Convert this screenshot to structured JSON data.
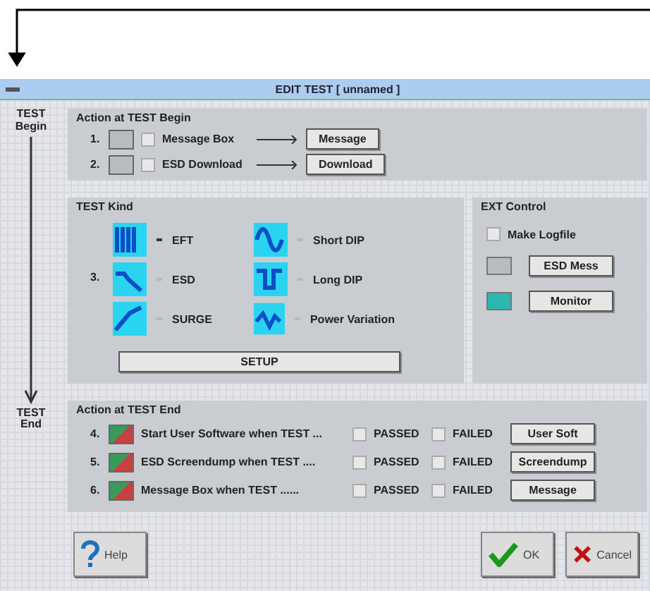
{
  "window": {
    "title": "EDIT TEST [ unnamed ]"
  },
  "timeline": {
    "start_label": "TEST Begin",
    "end_label": "TEST End"
  },
  "begin_actions": {
    "title": "Action at TEST Begin",
    "rows": [
      {
        "number": "1.",
        "label": "Message Box",
        "checked": false,
        "button": "Message"
      },
      {
        "number": "2.",
        "label": "ESD Download",
        "checked": false,
        "button": "Download"
      }
    ]
  },
  "test_kind": {
    "title": "TEST Kind",
    "number": "3.",
    "options": [
      {
        "label": "EFT",
        "selected": true,
        "kind": "burst"
      },
      {
        "label": "Short DIP",
        "selected": false,
        "kind": "sine"
      },
      {
        "label": "ESD",
        "selected": false,
        "kind": "spike"
      },
      {
        "label": "Long DIP",
        "selected": false,
        "kind": "dip"
      },
      {
        "label": "SURGE",
        "selected": false,
        "kind": "ramp"
      },
      {
        "label": "Power Variation",
        "selected": false,
        "kind": "var"
      }
    ],
    "button": "SETUP"
  },
  "ext_control": {
    "title": "EXT Control",
    "logfile": {
      "label": "Make Logfile",
      "checked": false
    },
    "rows": [
      {
        "button": "ESD Mess",
        "on": false
      },
      {
        "button": "Monitor",
        "on": true
      }
    ]
  },
  "end_actions": {
    "title": "Action at TEST End",
    "rows": [
      {
        "number": "4.",
        "label": "Start User Software when TEST ...",
        "passed": false,
        "failed": false,
        "passed_label": "PASSED",
        "failed_label": "FAILED",
        "button": "User Soft"
      },
      {
        "number": "5.",
        "label": "ESD Screendump when TEST ....",
        "passed": false,
        "failed": false,
        "passed_label": "PASSED",
        "failed_label": "FAILED",
        "button": "Screendump"
      },
      {
        "number": "6.",
        "label": "Message Box when TEST ......",
        "passed": false,
        "failed": false,
        "passed_label": "PASSED",
        "failed_label": "FAILED",
        "button": "Message"
      }
    ]
  },
  "buttons": [
    {
      "kind": "help",
      "label": "Help"
    },
    {
      "kind": "ok",
      "label": "OK"
    },
    {
      "kind": "cancel",
      "label": "Cancel"
    }
  ]
}
